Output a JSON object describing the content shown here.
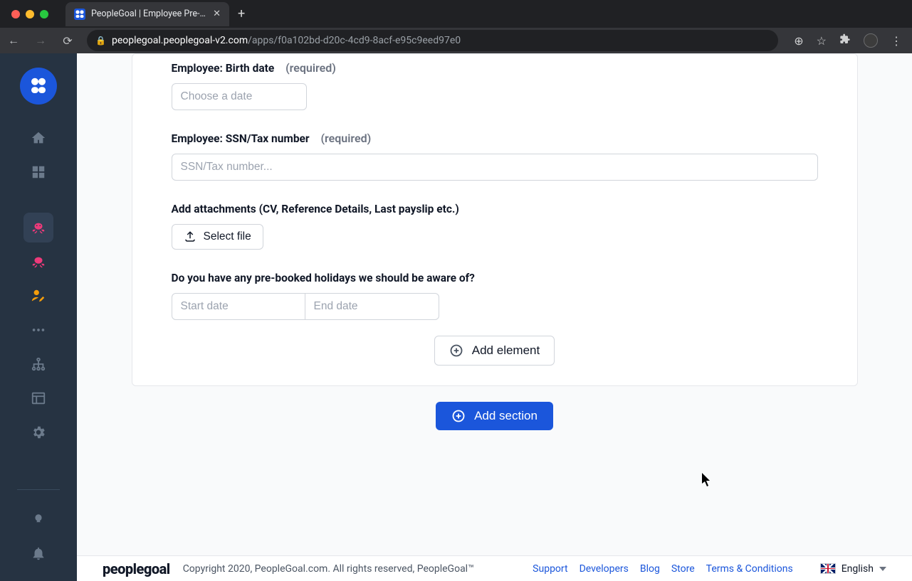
{
  "browser": {
    "tab_title": "PeopleGoal | Employee Pre-On",
    "url_host": "peoplegoal.peoplegoal-v2.com",
    "url_path": "/apps/f0a102bd-d20c-4cd9-8acf-e95c9eed97e0"
  },
  "form": {
    "birth_date": {
      "label": "Employee: Birth date",
      "required_text": "(required)",
      "placeholder": "Choose a date"
    },
    "ssn": {
      "label": "Employee: SSN/Tax number",
      "required_text": "(required)",
      "placeholder": "SSN/Tax number..."
    },
    "attachments": {
      "label": "Add attachments (CV, Reference Details, Last payslip etc.)",
      "button": "Select file"
    },
    "holidays": {
      "label": "Do you have any pre-booked holidays we should be aware of?",
      "start_placeholder": "Start date",
      "end_placeholder": "End date"
    },
    "add_element": "Add element",
    "add_section": "Add section"
  },
  "footer": {
    "brand": "peoplegoal",
    "copyright": "Copyright 2020, PeopleGoal.com. All rights reserved, PeopleGoal™",
    "links": {
      "support": "Support",
      "developers": "Developers",
      "blog": "Blog",
      "store": "Store",
      "terms": "Terms & Conditions"
    },
    "language": "English"
  }
}
